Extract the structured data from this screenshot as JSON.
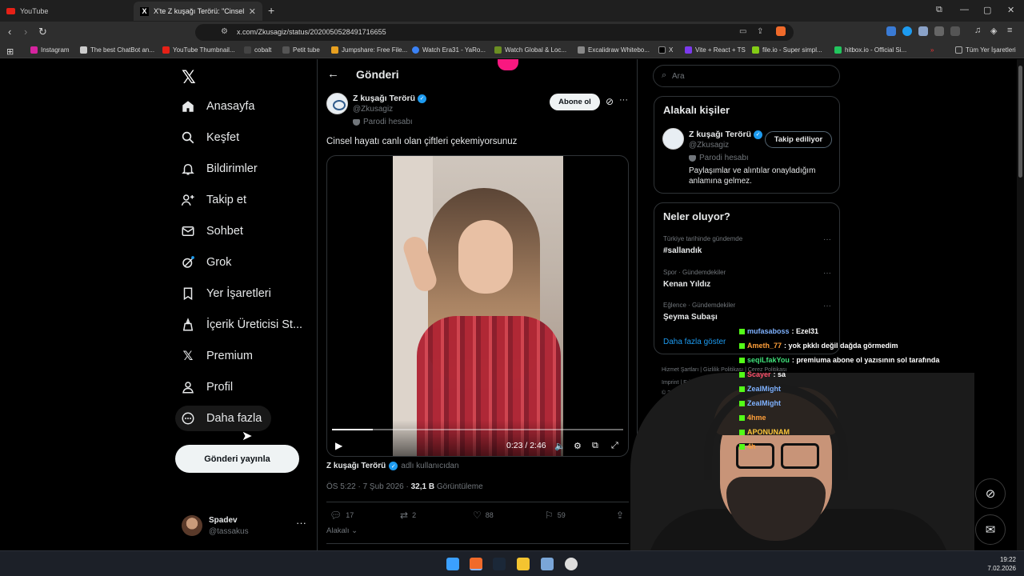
{
  "browser": {
    "tabs": [
      {
        "title": "YouTube",
        "active": false
      },
      {
        "title": "X'te Z kuşağı Terörü: \"Cinsel hay...",
        "active": true
      }
    ],
    "url": "x.com/Zkusagiz/status/2020050528491716655",
    "bookmarks": [
      "Instagram",
      "The best ChatBot an...",
      "YouTube Thumbnail...",
      "cobalt",
      "Petit tube",
      "Jumpshare: Free File...",
      "Watch Era31 - YaRo...",
      "Watch Global & Loc...",
      "Excalidraw Whitebo...",
      "X",
      "Vite + React + TS",
      "file.io - Super simpl...",
      "hitbox.io - Official Si..."
    ],
    "all_bookmarks": "Tüm Yer İşaretleri"
  },
  "nav": {
    "items": [
      {
        "label": "Anasayfa",
        "icon": "home-icon"
      },
      {
        "label": "Keşfet",
        "icon": "search-icon"
      },
      {
        "label": "Bildirimler",
        "icon": "bell-icon"
      },
      {
        "label": "Takip et",
        "icon": "follow-icon"
      },
      {
        "label": "Sohbet",
        "icon": "mail-icon"
      },
      {
        "label": "Grok",
        "icon": "grok-icon"
      },
      {
        "label": "Yer İşaretleri",
        "icon": "bookmark-icon"
      },
      {
        "label": "İçerik Üreticisi St...",
        "icon": "creator-icon"
      },
      {
        "label": "Premium",
        "icon": "x-icon"
      },
      {
        "label": "Profil",
        "icon": "person-icon"
      },
      {
        "label": "Daha fazla",
        "icon": "more-circle-icon"
      }
    ],
    "post_button": "Gönderi yayınla",
    "profile": {
      "name": "Spadev",
      "handle": "@tassakus"
    }
  },
  "post": {
    "header": "Gönderi",
    "author": "Z kuşağı Terörü",
    "handle": "@Zkusagiz",
    "parody": "Parodi hesabı",
    "subscribe": "Abone ol",
    "text": "Cinsel hayatı canlı olan çiftleri çekemiyorsunuz",
    "video": {
      "time": "0:23 / 2:46",
      "progress": 0.14
    },
    "attribution_name": "Z kuşağı Terörü",
    "attribution_suffix": "adlı kullanıcıdan",
    "timestamp": "ÖS 5:22 · 7 Şub 2026 ·",
    "views_count": "32,1 B",
    "views_label": "Görüntüleme",
    "actions": {
      "replies": "17",
      "reposts": "2",
      "likes": "88",
      "bookmarks": "59"
    },
    "related": "Alakalı"
  },
  "sidebar": {
    "search_placeholder": "Ara",
    "relevant": {
      "title": "Alakalı kişiler",
      "name": "Z kuşağı Terörü",
      "handle": "@Zkusagiz",
      "parody": "Parodi hesabı",
      "bio": "Paylaşımlar ve alıntılar onayladığım anlamına gelmez.",
      "follow_state": "Takip ediliyor"
    },
    "trends": {
      "title": "Neler oluyor?",
      "items": [
        {
          "context": "Türkiye tarihinde gündemde",
          "topic": "#sallandık"
        },
        {
          "context": "Spor · Gündemdekiler",
          "topic": "Kenan Yıldız"
        },
        {
          "context": "Eğlence · Gündemdekiler",
          "topic": "Şeyma Subaşı"
        }
      ],
      "show_more": "Daha fazla göster"
    },
    "footer": {
      "line1": "Hizmet Şartları  |  Gizlilik Politikası  |  Çerez Politikası",
      "line2": "Imprint  |  Erişilebilirlik  |  Reklam bilgisi  |  Daha fazla ...",
      "line3": "© 2026 X Corp."
    }
  },
  "chat": [
    {
      "user": "mufasaboss",
      "message": ": Ezel31",
      "color": "#7fb2ff"
    },
    {
      "user": "Ameth_77",
      "message": ": yok pkklı değil dağda görmedim",
      "color": "#ff9f3a"
    },
    {
      "user": "seqiLfakYou",
      "message": ": premiuma abone ol yazısının sol tarafında",
      "color": "#40e07a"
    },
    {
      "user": "Scayer",
      "message": ": sa",
      "color": "#ff4f6a"
    },
    {
      "user": "ZealMight",
      "message": "",
      "color": "#7fb2ff"
    },
    {
      "user": "ZealMight",
      "message": "",
      "color": "#7fb2ff"
    },
    {
      "user": "4hme",
      "message": "",
      "color": "#ff9f3a"
    },
    {
      "user": "APONUNAM",
      "message": "",
      "color": "#ffc83a"
    },
    {
      "user": "4h",
      "message": "",
      "color": "#ff9f3a"
    }
  ],
  "taskbar": {
    "time": "19:22",
    "date": "7.02.2026"
  },
  "colors": {
    "accent": "#1d9bf0",
    "chat_badge": "#53fc18",
    "live": "#f91880"
  }
}
